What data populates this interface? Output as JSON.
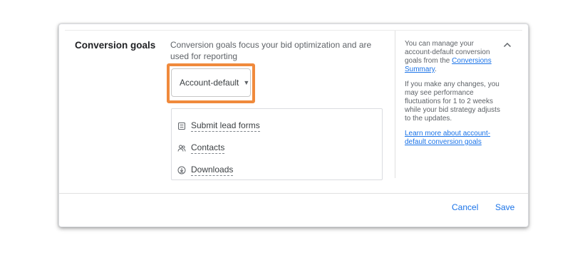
{
  "section": {
    "title": "Conversion goals",
    "description": "Conversion goals focus your bid optimization and are used for reporting"
  },
  "dropdown": {
    "selected": "Account-default"
  },
  "goals": [
    {
      "label": "Submit lead forms",
      "icon": "form-icon"
    },
    {
      "label": "Contacts",
      "icon": "contacts-icon"
    },
    {
      "label": "Downloads",
      "icon": "download-icon"
    }
  ],
  "side_panel": {
    "p1_text": "You can manage your account-default conversion goals from the ",
    "p1_link": "Conversions Summary",
    "p1_end": ".",
    "p2_text": "If you make any changes, you may see performance fluctuations for 1 to 2 weeks while your bid strategy adjusts to the updates.",
    "learn_more_link": "Learn more about account-default conversion goals"
  },
  "actions": {
    "cancel": "Cancel",
    "save": "Save"
  },
  "colors": {
    "accent": "#1a73e8",
    "highlight": "#f08a3c"
  }
}
